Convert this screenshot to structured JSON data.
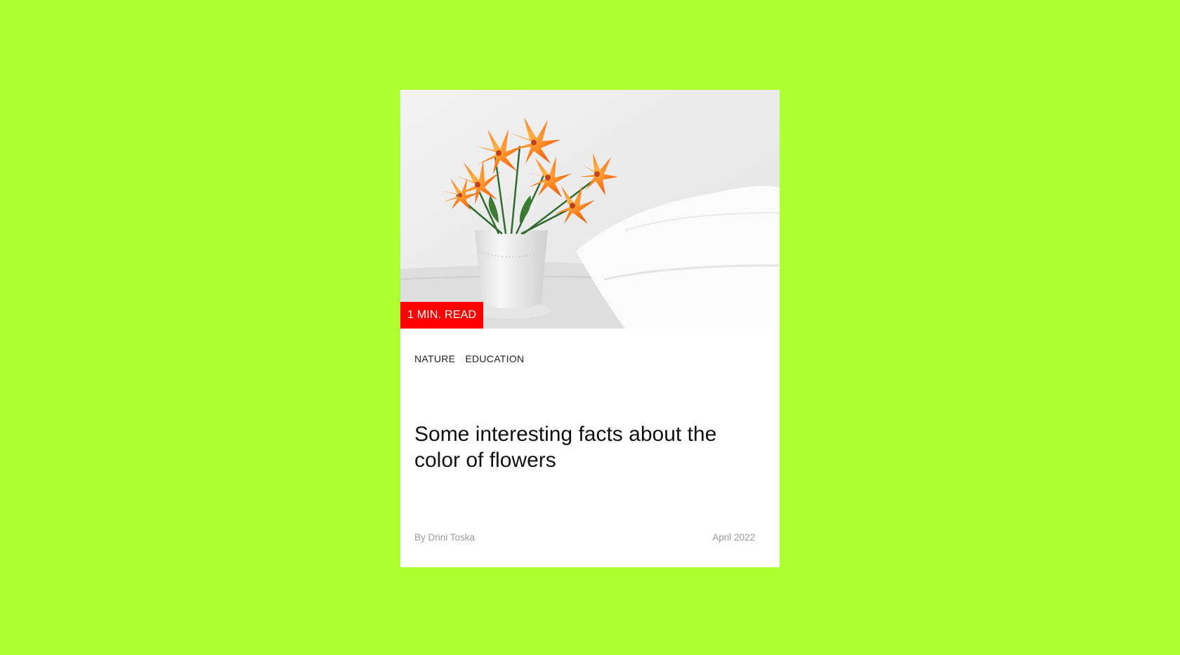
{
  "card": {
    "badge": "1 MIN. READ",
    "tags": [
      "NATURE",
      "EDUCATION"
    ],
    "title": "Some interesting facts about the color of flowers",
    "author": "By Drini Toska",
    "date": "April 2022"
  },
  "image": {
    "subject": "orange lilies in a white vase",
    "icon": "flower-photo"
  },
  "colors": {
    "background": "#adff2f",
    "badge": "#ff0000",
    "card": "#ffffff"
  }
}
